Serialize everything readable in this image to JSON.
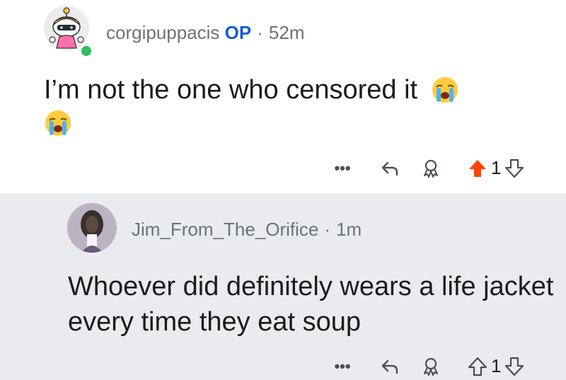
{
  "comments": [
    {
      "username": "corgipuppacis",
      "op_badge": "OP",
      "separator": "·",
      "age": "52m",
      "text": "I’m not the one who censored it",
      "emoji": "loudly-crying-face",
      "vote_count": "1",
      "upvoted": true,
      "online": true,
      "more_label": "•••"
    },
    {
      "username": "Jim_From_The_Orifice",
      "separator": "·",
      "age": "1m",
      "text": "Whoever did definitely wears a life jacket every time they eat soup",
      "vote_count": "1",
      "upvoted": false,
      "more_label": "•••"
    }
  ],
  "colors": {
    "upvote_active": "#ff4500",
    "op_badge": "#1a5cd1",
    "meta_text": "#6c7378",
    "online_dot": "#2cbf55",
    "reply_background": "#e9ebee"
  }
}
